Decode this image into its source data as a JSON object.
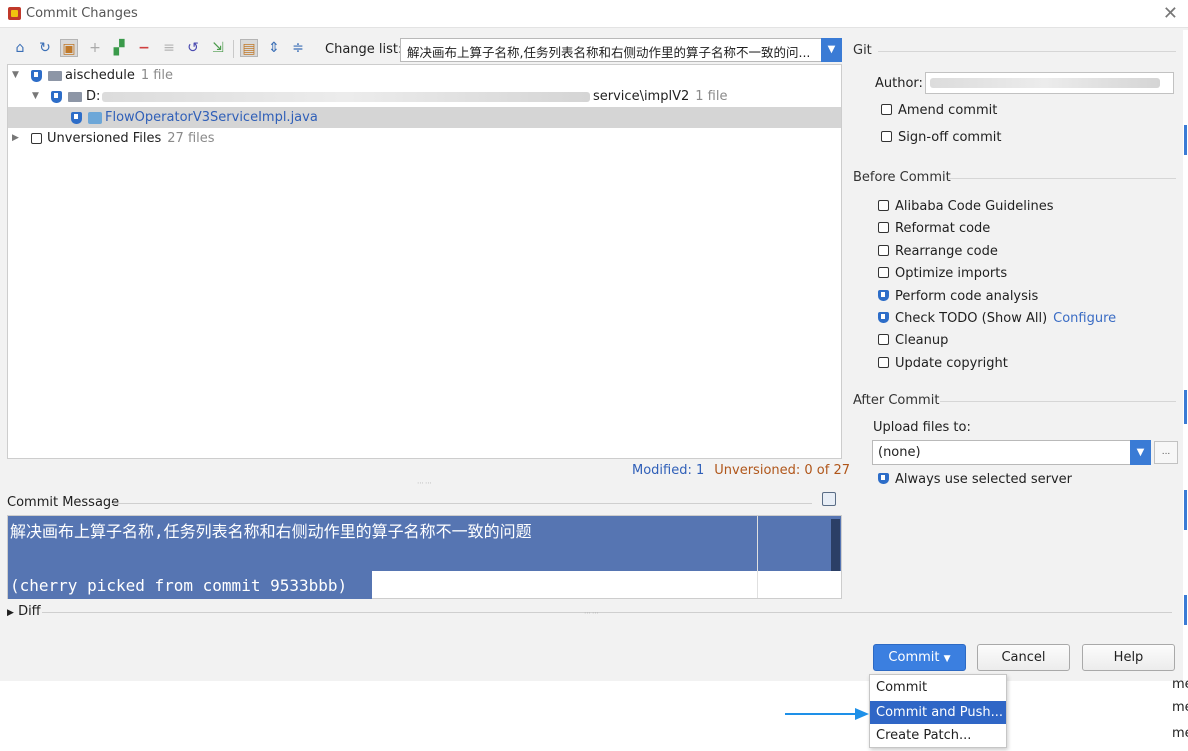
{
  "window": {
    "title": "Commit Changes"
  },
  "toolbar": {
    "change_list_label": "Change list:",
    "change_list_value": "解决画布上算子名称,任务列表名称和右侧动作里的算子名称不一致的问...",
    "icons": [
      "commit-icon",
      "refresh-icon",
      "highlight-icon",
      "add-icon",
      "move-icon",
      "remove-icon",
      "diff-icon",
      "rollback-icon",
      "jump-icon",
      "group-icon",
      "expand-all-icon",
      "collapse-all-icon"
    ]
  },
  "tree": {
    "root": {
      "name": "aischedule",
      "count": "1 file"
    },
    "path": {
      "prefix": "D:",
      "suffix": "service\\implV2",
      "count": "1 file"
    },
    "file": {
      "name": "FlowOperatorV3ServiceImpl.java"
    },
    "unversioned": {
      "name": "Unversioned Files",
      "count": "27 files"
    }
  },
  "status": {
    "modified": "Modified: 1",
    "unversioned": "Unversioned: 0 of 27"
  },
  "commit_message": {
    "label": "Commit Message",
    "line1": "解决画布上算子名称,任务列表名称和右侧动作里的算子名称不一致的问题",
    "line2": "(cherry picked from commit 9533bbb)"
  },
  "diff": {
    "label": "Diff"
  },
  "git": {
    "title": "Git",
    "author_label": "Author:",
    "amend": "Amend commit",
    "signoff": "Sign-off commit"
  },
  "before_commit": {
    "title": "Before Commit",
    "items": [
      {
        "label": "Alibaba Code Guidelines",
        "checked": false
      },
      {
        "label": "Reformat code",
        "checked": false
      },
      {
        "label": "Rearrange code",
        "checked": false
      },
      {
        "label": "Optimize imports",
        "checked": false
      },
      {
        "label": "Perform code analysis",
        "checked": true
      },
      {
        "label": "Check TODO (Show All)",
        "checked": true
      },
      {
        "label": "Cleanup",
        "checked": false
      },
      {
        "label": "Update copyright",
        "checked": false
      }
    ],
    "configure": "Configure"
  },
  "after_commit": {
    "title": "After Commit",
    "upload_label": "Upload files to:",
    "upload_value": "(none)",
    "browse": "...",
    "always_use": "Always use selected server"
  },
  "buttons": {
    "commit": "Commit",
    "cancel": "Cancel",
    "help": "Help"
  },
  "commit_menu": {
    "items": [
      "Commit",
      "Commit and Push...",
      "Create Patch..."
    ]
  },
  "side_text": [
    "me",
    "me",
    "me"
  ],
  "colors": {
    "accent": "#3b7fe0",
    "selection": "#5675b2",
    "annotation_arrow": "#1e90e8"
  }
}
